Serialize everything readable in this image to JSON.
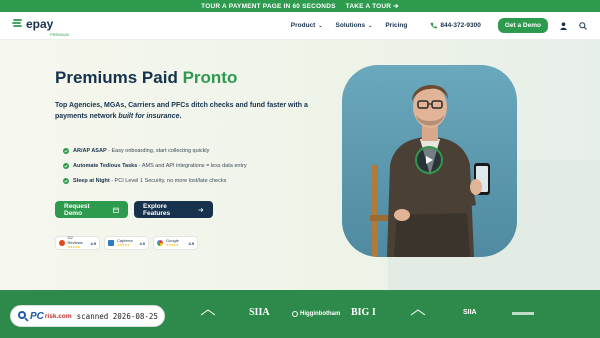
{
  "topbar": {
    "message": "TOUR A PAYMENT PAGE IN 60 SECONDS",
    "cta": "TAKE A TOUR ➔"
  },
  "nav": {
    "logo": "epay",
    "logo_sub": "PREMIUM",
    "items": [
      {
        "label": "Product",
        "chevron": "⌄"
      },
      {
        "label": "Solutions",
        "chevron": "⌄"
      },
      {
        "label": "Pricing"
      }
    ],
    "phone": "844-372-9300",
    "demo_button": "Get a Demo"
  },
  "hero": {
    "title_main": "Premiums Paid ",
    "title_accent": "Pronto",
    "subtitle_main": "Top Agencies, MGAs, Carriers and PFCs ditch checks and fund faster with a payments network ",
    "subtitle_em": "built for insurance",
    "subtitle_end": ".",
    "bullets": [
      {
        "bold": "AR/AP ASAP",
        "rest": " - Easy onboarding, start collecting quickly"
      },
      {
        "bold": "Automate Tedious Tasks",
        "rest": " - AMS and API integrations = less data entry"
      },
      {
        "bold": "Sleep at Night",
        "rest": " - PCI Level 1 Security, no more lost/late checks"
      }
    ],
    "request_demo": "Request Demo",
    "explore": "Explore Features",
    "reviews": [
      {
        "name": "G2 Reviews",
        "stars": "★★★★★",
        "score": "4.9",
        "color": "#e64a19"
      },
      {
        "name": "Capterra",
        "stars": "★★★★★",
        "score": "4.9",
        "color": "#2d7cc1"
      },
      {
        "name": "Google",
        "stars": "★★★★★",
        "score": "4.9",
        "color": "#4285f4"
      }
    ]
  },
  "partners": [
    "SIIA",
    "Higginbotham",
    "BIG I",
    "SIIA"
  ],
  "watermark": {
    "brand": "PC",
    "brand2": "risk.com",
    "text": "scanned 2026-08-25"
  },
  "colors": {
    "green": "#2e9a4e",
    "navy": "#17324d",
    "footer": "#2e8a4a"
  }
}
